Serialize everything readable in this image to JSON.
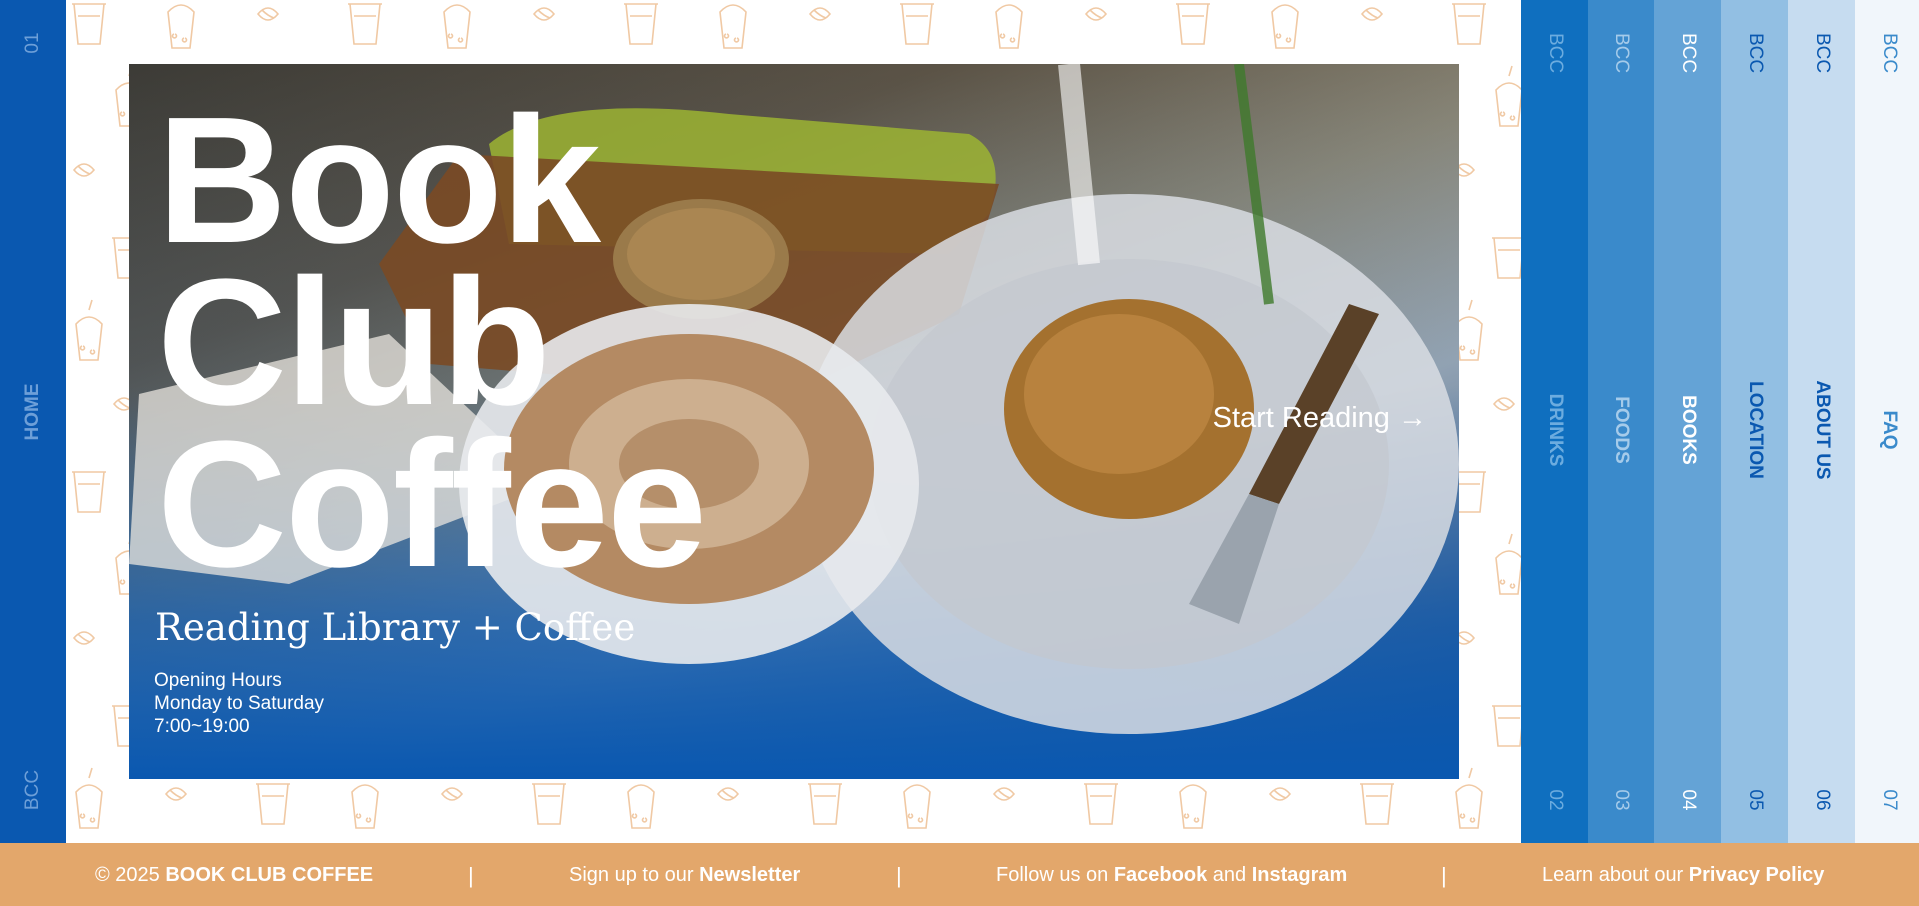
{
  "left_rail": {
    "number": "01",
    "label": "HOME",
    "brand": "BCC"
  },
  "hero": {
    "title_lines": [
      "Book",
      "Club",
      "Coffee"
    ],
    "subtitle": "Reading Library + Coffee",
    "hours_title": "Opening Hours",
    "hours_days": "Monday to Saturday",
    "hours_time": "7:00~19:00",
    "cta_label": "Start Reading →"
  },
  "tabs": [
    {
      "brand": "BCC",
      "label": "DRINKS",
      "number": "02",
      "bg": "#0f6fbf",
      "fg": "#6cacdf"
    },
    {
      "brand": "BCC",
      "label": "FOODS",
      "number": "03",
      "bg": "#3a8acb",
      "fg": "#a5cbea"
    },
    {
      "brand": "BCC",
      "label": "BOOKS",
      "number": "04",
      "bg": "#64a3d6",
      "fg": "#ffffff"
    },
    {
      "brand": "BCC",
      "label": "LOCATION",
      "number": "05",
      "bg": "#92bfe3",
      "fg": "#0a58b0"
    },
    {
      "brand": "BCC",
      "label": "ABOUT US",
      "number": "06",
      "bg": "#c6dcf0",
      "fg": "#0a58b0"
    },
    {
      "brand": "BCC",
      "label": "FAQ",
      "number": "07",
      "bg": "#f1f6fb",
      "fg": "#3a8acb"
    }
  ],
  "footer": {
    "copyright_prefix": "© 2025 ",
    "copyright_brand": "BOOK CLUB COFFEE",
    "separator": "|",
    "newsletter_prefix": "Sign up to our ",
    "newsletter_link": "Newsletter",
    "follow_prefix": "Follow us on ",
    "facebook": "Facebook",
    "follow_and": " and ",
    "instagram": "Instagram",
    "privacy_prefix": "Learn about our ",
    "privacy_link": "Privacy Policy"
  },
  "colors": {
    "primary_blue": "#0a58b0",
    "footer_orange": "#e3a76b",
    "pattern_stroke": "#f0c9a4"
  },
  "icons": [
    "coffee-cup-icon",
    "bubble-tea-icon",
    "coffee-bean-icon"
  ]
}
